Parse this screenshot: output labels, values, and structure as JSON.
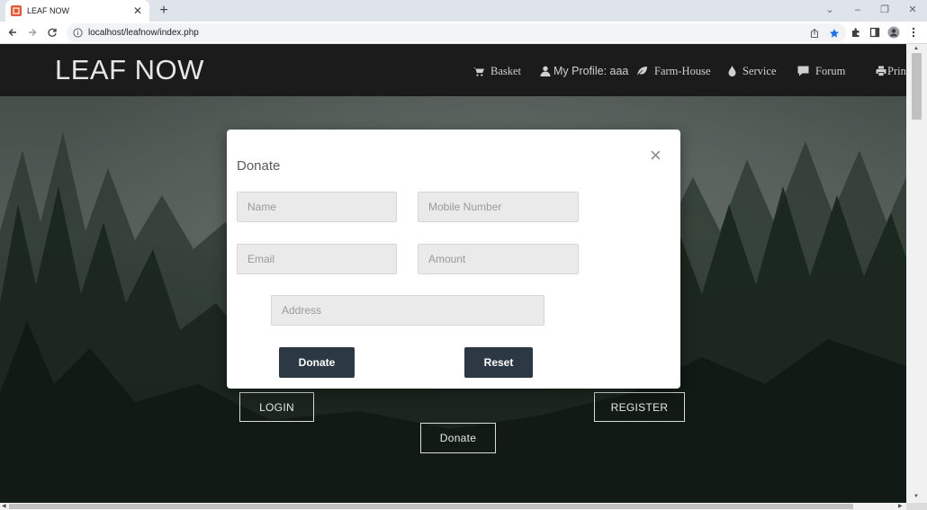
{
  "browser": {
    "tab_title": "LEAF NOW",
    "new_tab": "+",
    "url": "localhost/leafnow/index.php"
  },
  "site": {
    "brand": "LEAF NOW",
    "nav": [
      {
        "label": "Basket",
        "icon": "cart-icon"
      },
      {
        "label": "My Profile: aaa",
        "icon": "user-icon"
      },
      {
        "label": "Farm-House",
        "icon": "leaf-icon"
      },
      {
        "label": "Service",
        "icon": "drop-icon"
      },
      {
        "label": "Forum",
        "icon": "comment-icon"
      },
      {
        "label": "Print",
        "icon": "print-icon"
      }
    ]
  },
  "hero": {
    "login_label": "LOGIN",
    "register_label": "REGISTER",
    "donate_label": "Donate"
  },
  "modal": {
    "title": "Donate",
    "close": "×",
    "name_placeholder": "Name",
    "mobile_placeholder": "Mobile Number",
    "email_placeholder": "Email",
    "amount_placeholder": "Amount",
    "address_placeholder": "Address",
    "donate_button": "Donate",
    "reset_button": "Reset"
  },
  "colors": {
    "navbar": "#1b1b1b",
    "button_dark": "#2c3945",
    "field_bg": "#eaeaea"
  }
}
